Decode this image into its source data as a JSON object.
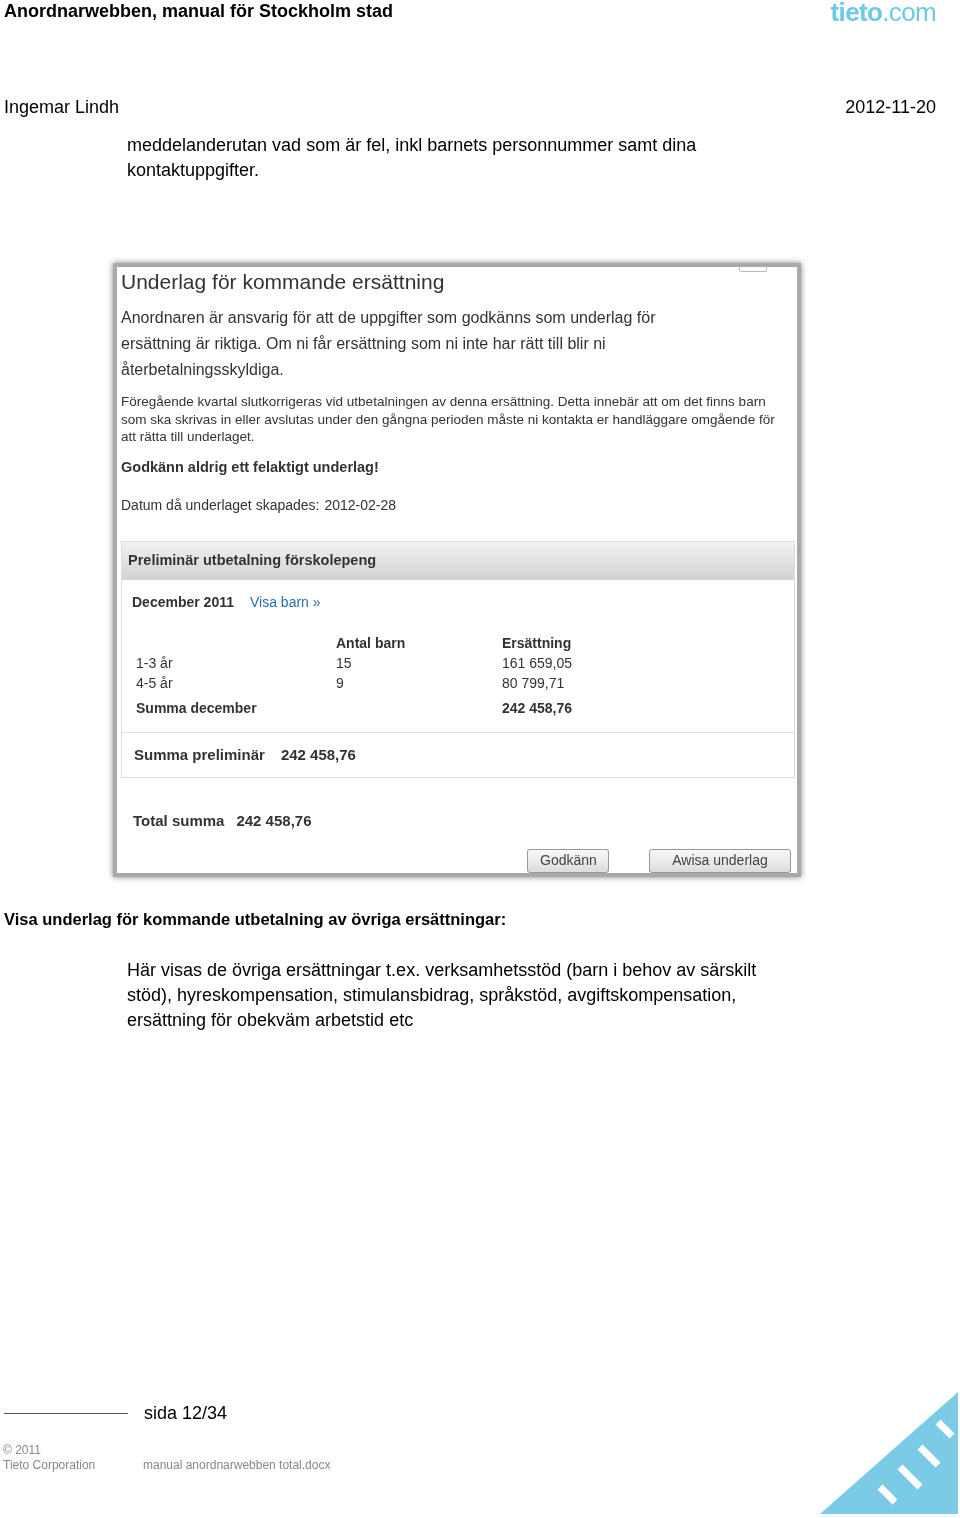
{
  "header": {
    "title": "Anordnarwebben, manual för Stockholm stad",
    "logo": "**tieto**.com",
    "author": "Ingemar Lindh",
    "date": "2012-11-20"
  },
  "intro": "meddelanderutan vad som är fel, inkl barnets personnummer samt dina kontaktuppgifter.",
  "dialog": {
    "title": "Underlag för kommande ersättning",
    "lead": "Anordnaren är ansvarig för att de uppgifter som godkänns som underlag för ersättning är riktiga. Om ni får ersättning som ni inte har rätt till blir ni återbetalningsskyldiga.",
    "note": "Föregående kvartal slutkorrigeras vid utbetalningen av denna ersättning. Detta innebär att om det finns barn som ska skrivas in eller avslutas under den gångna perioden måste ni kontakta er handläggare omgående för att rätta till underlaget.",
    "warning": "Godkänn aldrig ett felaktigt underlag!",
    "created_label": "Datum då underlaget skapades:",
    "created": "2012-02-28",
    "panel": {
      "title": "Preliminär utbetalning förskolepeng",
      "month": "December 2011",
      "link": "Visa barn »",
      "columns": [
        "Antal barn",
        "Ersättning"
      ],
      "rows": [
        {
          "label": "1-3 år",
          "count": "15",
          "amount": "161 659,05"
        },
        {
          "label": "4-5 år",
          "count": "9",
          "amount": "80 799,71"
        }
      ],
      "sum_label": "Summa december",
      "sum": "242 458,76",
      "prelim_label": "Summa preliminär",
      "prelim": "242 458,76"
    },
    "total_label": "Total summa",
    "total": "242 458,76",
    "buttons": [
      "Godkänn",
      "Awisa underlag"
    ]
  },
  "heading": "Visa underlag för kommande utbetalning av övriga ersättningar:",
  "body": "Här visas de övriga ersättningar t.ex. verksamhetsstöd (barn i behov av särskilt stöd), hyreskompensation, stimulansbidrag, språkstöd,  avgiftskompensation, ersättning för obekväm arbetstid etc",
  "footer": {
    "page": "sida 12/34",
    "copyright": "© 2011",
    "company": "Tieto Corporation",
    "file": "manual anordnarwebben total.docx"
  }
}
